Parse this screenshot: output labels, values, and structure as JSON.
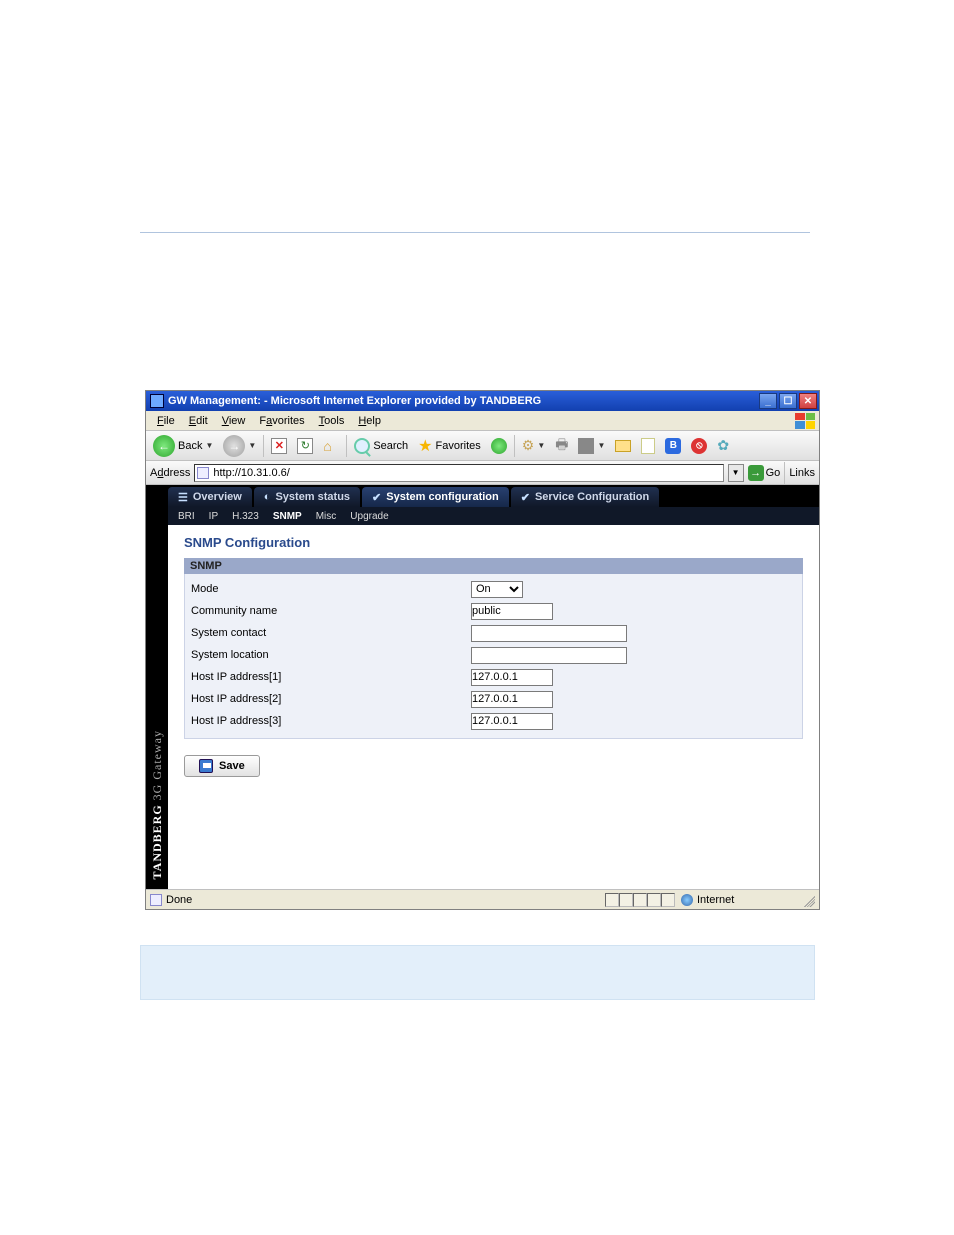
{
  "window": {
    "title": "GW Management: - Microsoft Internet Explorer provided by TANDBERG"
  },
  "menu": {
    "file": "File",
    "edit": "Edit",
    "view": "View",
    "favorites": "Favorites",
    "tools": "Tools",
    "help": "Help"
  },
  "toolbar": {
    "back": "Back",
    "search": "Search",
    "favorites": "Favorites"
  },
  "address": {
    "label": "Address",
    "value": "http://10.31.0.6/",
    "go": "Go",
    "links": "Links"
  },
  "sidebar": {
    "brand_bold": "TANDBERG",
    "brand_light": " 3G Gateway"
  },
  "tabs": {
    "overview": "Overview",
    "status": "System status",
    "sysconf": "System configuration",
    "svcconf": "Service Configuration"
  },
  "subtabs": {
    "bri": "BRI",
    "ip": "IP",
    "h323": "H.323",
    "snmp": "SNMP",
    "misc": "Misc",
    "upgrade": "Upgrade"
  },
  "page": {
    "heading": "SNMP Configuration",
    "section": "SNMP",
    "fields": {
      "mode_label": "Mode",
      "mode_value": "On",
      "community_label": "Community name",
      "community_value": "public",
      "contact_label": "System contact",
      "contact_value": "",
      "location_label": "System location",
      "location_value": "",
      "host1_label": "Host IP address[1]",
      "host1_value": "127.0.0.1",
      "host2_label": "Host IP address[2]",
      "host2_value": "127.0.0.1",
      "host3_label": "Host IP address[3]",
      "host3_value": "127.0.0.1"
    },
    "save": "Save"
  },
  "status": {
    "text": "Done",
    "zone": "Internet"
  }
}
